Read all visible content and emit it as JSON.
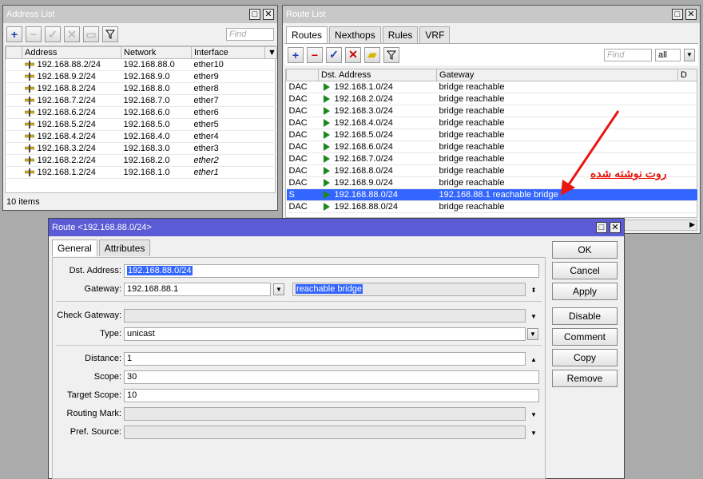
{
  "address_list": {
    "title": "Address List",
    "find_placeholder": "Find",
    "columns": [
      "Address",
      "Network",
      "Interface"
    ],
    "rows": [
      {
        "address": "192.168.88.2/24",
        "network": "192.168.88.0",
        "interface": "ether10",
        "italic": false
      },
      {
        "address": "192.168.9.2/24",
        "network": "192.168.9.0",
        "interface": "ether9",
        "italic": false
      },
      {
        "address": "192.168.8.2/24",
        "network": "192.168.8.0",
        "interface": "ether8",
        "italic": false
      },
      {
        "address": "192.168.7.2/24",
        "network": "192.168.7.0",
        "interface": "ether7",
        "italic": false
      },
      {
        "address": "192.168.6.2/24",
        "network": "192.168.6.0",
        "interface": "ether6",
        "italic": false
      },
      {
        "address": "192.168.5.2/24",
        "network": "192.168.5.0",
        "interface": "ether5",
        "italic": false
      },
      {
        "address": "192.168.4.2/24",
        "network": "192.168.4.0",
        "interface": "ether4",
        "italic": false
      },
      {
        "address": "192.168.3.2/24",
        "network": "192.168.3.0",
        "interface": "ether3",
        "italic": false
      },
      {
        "address": "192.168.2.2/24",
        "network": "192.168.2.0",
        "interface": "ether2",
        "italic": true
      },
      {
        "address": "192.168.1.2/24",
        "network": "192.168.1.0",
        "interface": "ether1",
        "italic": true
      }
    ],
    "status": "10 items"
  },
  "route_list": {
    "title": "Route List",
    "tabs": [
      "Routes",
      "Nexthops",
      "Rules",
      "VRF"
    ],
    "find_placeholder": "Find",
    "filter_value": "all",
    "columns": [
      "Dst. Address",
      "Gateway",
      "D"
    ],
    "rows": [
      {
        "flag": "DAC",
        "dst": "192.168.1.0/24",
        "gateway": "bridge reachable",
        "selected": false
      },
      {
        "flag": "DAC",
        "dst": "192.168.2.0/24",
        "gateway": "bridge reachable",
        "selected": false
      },
      {
        "flag": "DAC",
        "dst": "192.168.3.0/24",
        "gateway": "bridge reachable",
        "selected": false
      },
      {
        "flag": "DAC",
        "dst": "192.168.4.0/24",
        "gateway": "bridge reachable",
        "selected": false
      },
      {
        "flag": "DAC",
        "dst": "192.168.5.0/24",
        "gateway": "bridge reachable",
        "selected": false
      },
      {
        "flag": "DAC",
        "dst": "192.168.6.0/24",
        "gateway": "bridge reachable",
        "selected": false
      },
      {
        "flag": "DAC",
        "dst": "192.168.7.0/24",
        "gateway": "bridge reachable",
        "selected": false
      },
      {
        "flag": "DAC",
        "dst": "192.168.8.0/24",
        "gateway": "bridge reachable",
        "selected": false
      },
      {
        "flag": "DAC",
        "dst": "192.168.9.0/24",
        "gateway": "bridge reachable",
        "selected": false
      },
      {
        "flag": "S",
        "dst": "192.168.88.0/24",
        "gateway": "192.168.88.1 reachable bridge",
        "selected": true
      },
      {
        "flag": "DAC",
        "dst": "192.168.88.0/24",
        "gateway": "bridge reachable",
        "selected": false
      }
    ],
    "annotation": "روت نوشته شده",
    "annotation_color": "#e8170f"
  },
  "route_dialog": {
    "title": "Route <192.168.88.0/24>",
    "tabs": [
      "General",
      "Attributes"
    ],
    "labels": {
      "dst": "Dst. Address:",
      "gateway": "Gateway:",
      "check_gateway": "Check Gateway:",
      "type": "Type:",
      "distance": "Distance:",
      "scope": "Scope:",
      "target_scope": "Target Scope:",
      "routing_mark": "Routing Mark:",
      "pref_source": "Pref. Source:"
    },
    "values": {
      "dst": "192.168.88.0/24",
      "gateway": "192.168.88.1",
      "gateway_status": "reachable bridge",
      "check_gateway": "",
      "type": "unicast",
      "distance": "1",
      "scope": "30",
      "target_scope": "10",
      "routing_mark": "",
      "pref_source": ""
    },
    "buttons": [
      "OK",
      "Cancel",
      "Apply",
      "Disable",
      "Comment",
      "Copy",
      "Remove"
    ]
  }
}
